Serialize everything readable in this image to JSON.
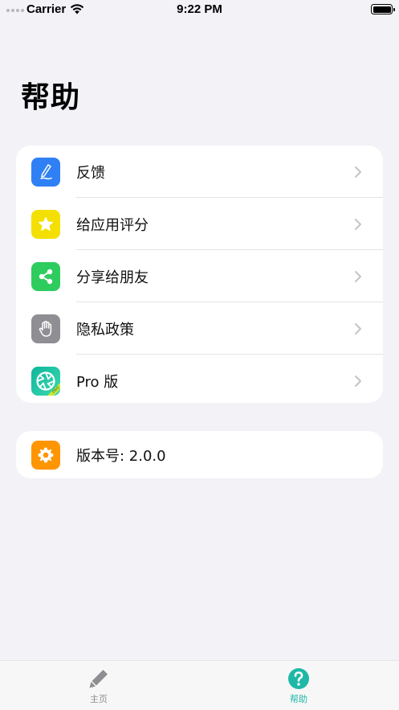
{
  "status_bar": {
    "carrier": "Carrier",
    "time": "9:22 PM"
  },
  "page": {
    "title": "帮助"
  },
  "menu": {
    "items": [
      {
        "label": "反馈",
        "icon": "pen-icon",
        "color": "#2f80f5"
      },
      {
        "label": "给应用评分",
        "icon": "star-icon",
        "color": "#f4e000"
      },
      {
        "label": "分享给朋友",
        "icon": "share-icon",
        "color": "#2ecc5e"
      },
      {
        "label": "隐私政策",
        "icon": "hand-icon",
        "color": "#8e8e93"
      },
      {
        "label": "Pro 版",
        "icon": "pro-app-icon",
        "color": "#18c7a8"
      }
    ]
  },
  "version": {
    "label": "版本号: 2.0.0",
    "icon": "gear-icon",
    "color": "#ff9500"
  },
  "tab_bar": {
    "tabs": [
      {
        "label": "主页",
        "icon": "pencil-icon",
        "active": false
      },
      {
        "label": "帮助",
        "icon": "question-icon",
        "active": true
      }
    ],
    "active_color": "#1fb8a7",
    "inactive_color": "#8e8e93"
  }
}
